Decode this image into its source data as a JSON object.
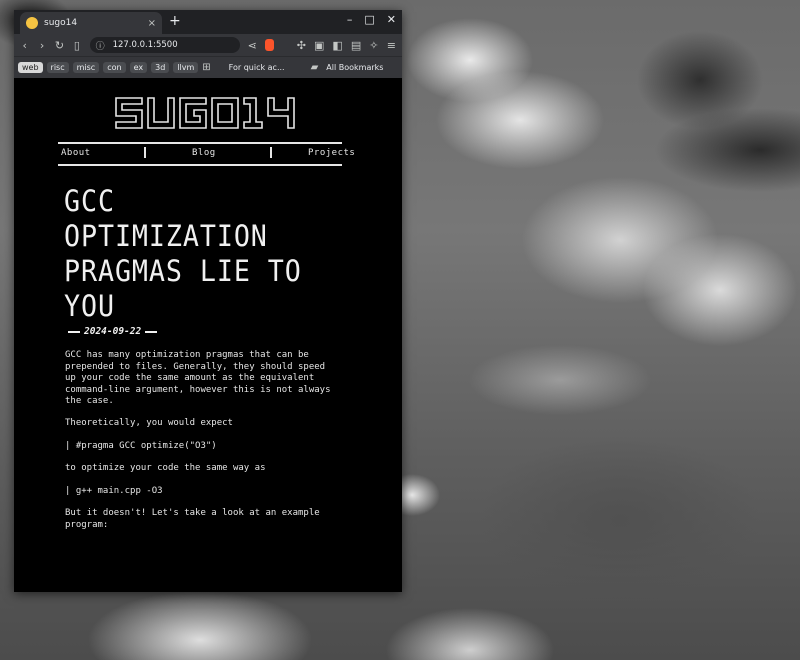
{
  "browser": {
    "tab_title": "sugo14",
    "new_tab": "+",
    "tab_close": "×",
    "url": "127.0.0.1:5500",
    "window_controls": {
      "minimize": "–",
      "maximize": "□",
      "close": "✕"
    }
  },
  "toolbar_icons": [
    "back-icon",
    "forward-icon",
    "reload-icon",
    "bookmark-icon",
    "share-icon",
    "brave-shield-icon",
    "extensions-icon",
    "screenshot-icon",
    "sidebar-icon",
    "wallet-icon",
    "leo-icon",
    "menu-icon"
  ],
  "bookmarks": {
    "items": [
      "web",
      "risc",
      "misc",
      "con",
      "ex",
      "3d",
      "llvm"
    ],
    "quick_access": "For quick ac...",
    "all_bookmarks": "All Bookmarks"
  },
  "site": {
    "logo_text": "SUGO14",
    "nav": {
      "about": "About",
      "blog": "Blog",
      "projects": "Projects"
    }
  },
  "post": {
    "title": "GCC optimization pragmas lie to you",
    "date": "2024-09-22",
    "paragraphs": [
      "GCC has many optimization pragmas that can be\nprepended to files. Generally, they should speed\nup your code the same amount as the equivalent\ncommand-line argument, however this is not always\nthe case.",
      "Theoretically, you would expect",
      "| #pragma GCC optimize(\"O3\")",
      "to optimize your code the same way as",
      "| g++ main.cpp -O3",
      "But it doesn't! Let's take a look at an example\nprogram:"
    ]
  },
  "colors": {
    "page_bg": "#000000",
    "text": "#e6e6e6",
    "chrome_dark": "#202124",
    "chrome": "#35363a"
  }
}
